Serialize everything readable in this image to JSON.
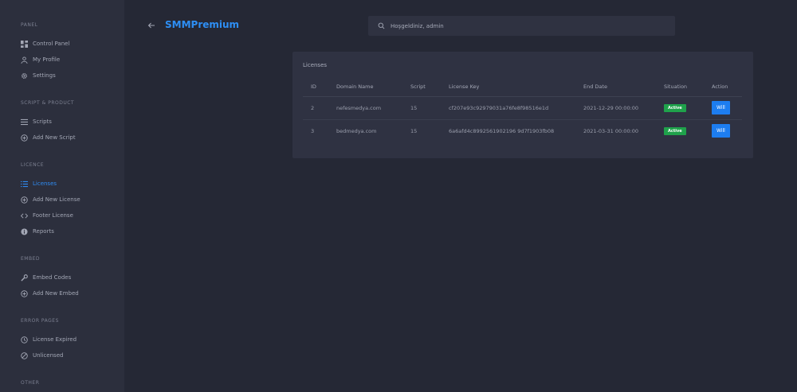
{
  "sidebar": {
    "sections": [
      {
        "title": "PANEL",
        "items": [
          {
            "label": "Control Panel",
            "icon": "dashboard-icon"
          },
          {
            "label": "My Profile",
            "icon": "user-icon"
          },
          {
            "label": "Settings",
            "icon": "gear-icon"
          }
        ]
      },
      {
        "title": "SCRIPT & PRODUCT",
        "items": [
          {
            "label": "Scripts",
            "icon": "list-icon"
          },
          {
            "label": "Add New Script",
            "icon": "plus-circle-icon"
          }
        ]
      },
      {
        "title": "LICENCE",
        "items": [
          {
            "label": "Licenses",
            "icon": "list-icon",
            "active": true
          },
          {
            "label": "Add New License",
            "icon": "plus-circle-icon"
          },
          {
            "label": "Footer License",
            "icon": "code-icon"
          },
          {
            "label": "Reports",
            "icon": "info-icon"
          }
        ]
      },
      {
        "title": "EMBED",
        "items": [
          {
            "label": "Embed Codes",
            "icon": "wrench-icon"
          },
          {
            "label": "Add New Embed",
            "icon": "plus-circle-icon"
          }
        ]
      },
      {
        "title": "ERROR PAGES",
        "items": [
          {
            "label": "License Expired",
            "icon": "clock-icon"
          },
          {
            "label": "Unlicensed",
            "icon": "ban-icon"
          }
        ]
      },
      {
        "title": "OTHER",
        "items": []
      }
    ]
  },
  "header": {
    "brand": "SMMPremium",
    "search_placeholder": "Hoşgeldiniz, admin"
  },
  "licenses": {
    "title": "Licenses",
    "columns": [
      "ID",
      "Domain Name",
      "Script",
      "License Key",
      "End Date",
      "Situation",
      "Action"
    ],
    "rows": [
      {
        "id": "2",
        "domain": "nefesmedya.com",
        "script": "15",
        "key": "cf207e93c92979031a76fe8f98516e1d",
        "end_date": "2021-12-29 00:00:00",
        "status": "Active",
        "action": "Will"
      },
      {
        "id": "3",
        "domain": "bedmedya.com",
        "script": "15",
        "key": "6a6afd4c8992561902196 9d7f1903fb08",
        "end_date": "2021-03-31 00:00:00",
        "status": "Active",
        "action": "Will"
      }
    ]
  },
  "colors": {
    "accent": "#2e8ff5",
    "success": "#1fa24b",
    "button": "#1d7df0"
  }
}
